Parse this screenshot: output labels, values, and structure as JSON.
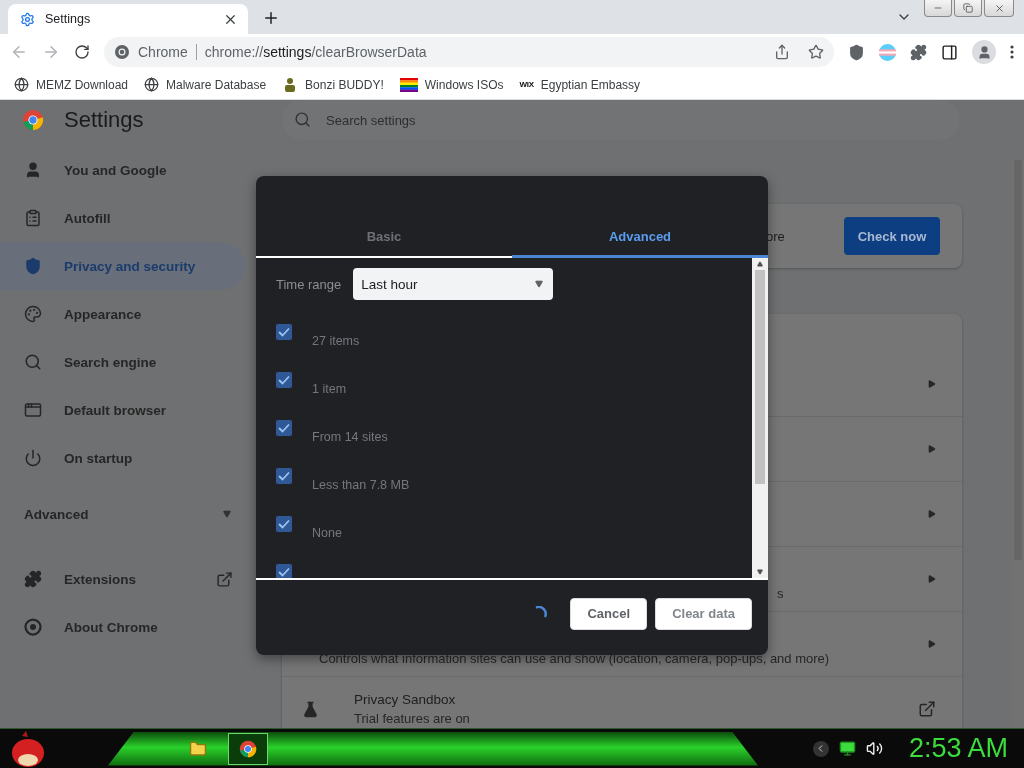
{
  "browser": {
    "tabs": [
      {
        "title": "Settings",
        "selected": true
      }
    ],
    "omnibox": {
      "site": "Chrome",
      "url_scheme": "chrome://",
      "url_host": "settings",
      "url_path": "/clearBrowserData"
    },
    "bookmarks": [
      {
        "kind": "globe",
        "label": "MEMZ Download"
      },
      {
        "kind": "globe",
        "label": "Malware Database"
      },
      {
        "kind": "figure",
        "label": "Bonzi BUDDY!"
      },
      {
        "kind": "flag",
        "label": "Windows ISOs"
      },
      {
        "kind": "logo",
        "logo_text": "WIX",
        "label": "Egyptian Embassy"
      }
    ]
  },
  "settings": {
    "title": "Settings",
    "search": {
      "placeholder": "Search settings"
    },
    "nav": [
      {
        "label": "You and Google",
        "selected": false
      },
      {
        "label": "Autofill",
        "selected": false
      },
      {
        "label": "Privacy and security",
        "selected": true
      },
      {
        "label": "Appearance",
        "selected": false
      },
      {
        "label": "Search engine",
        "selected": false
      },
      {
        "label": "Default browser",
        "selected": false
      },
      {
        "label": "On startup",
        "selected": false
      }
    ],
    "advanced": {
      "label": "Advanced",
      "expanded": false
    },
    "nav_extra": [
      {
        "label": "Extensions",
        "kind": "external"
      },
      {
        "label": "About Chrome",
        "kind": "plain"
      }
    ],
    "safety_check": {
      "text": "ore",
      "button": "Check now"
    },
    "rows": [
      {
        "kind": "arrow"
      },
      {
        "kind": "arrow"
      },
      {
        "kind": "arrow"
      },
      {
        "kind": "arrow",
        "subtitle": "s"
      },
      {
        "kind": "arrow",
        "subtitle": "Controls what information sites can use and show (location, camera, pop-ups, and more)"
      },
      {
        "kind": "external",
        "title": "Privacy Sandbox",
        "subtitle": "Trial features are on"
      }
    ]
  },
  "dialog": {
    "tabs": [
      {
        "label": "Basic",
        "selected": false
      },
      {
        "label": "Advanced",
        "selected": true
      }
    ],
    "time_range": {
      "label": "Time range",
      "value": "Last hour"
    },
    "items": [
      {
        "detail": "27 items",
        "checked": true
      },
      {
        "detail": "1 item",
        "checked": true
      },
      {
        "detail": "From 14 sites",
        "checked": true
      },
      {
        "detail": "Less than 7.8 MB",
        "checked": true
      },
      {
        "detail": "None",
        "checked": true
      },
      {
        "checked": true
      }
    ],
    "loading": true,
    "buttons": [
      {
        "label": "Cancel",
        "kind": "secondary"
      },
      {
        "label": "Clear data",
        "kind": "primary"
      }
    ]
  },
  "taskbar": {
    "apps": [
      {
        "kind": "folder",
        "selected": false
      },
      {
        "kind": "browser",
        "selected": true
      }
    ],
    "clock": "2:53 AM"
  }
}
